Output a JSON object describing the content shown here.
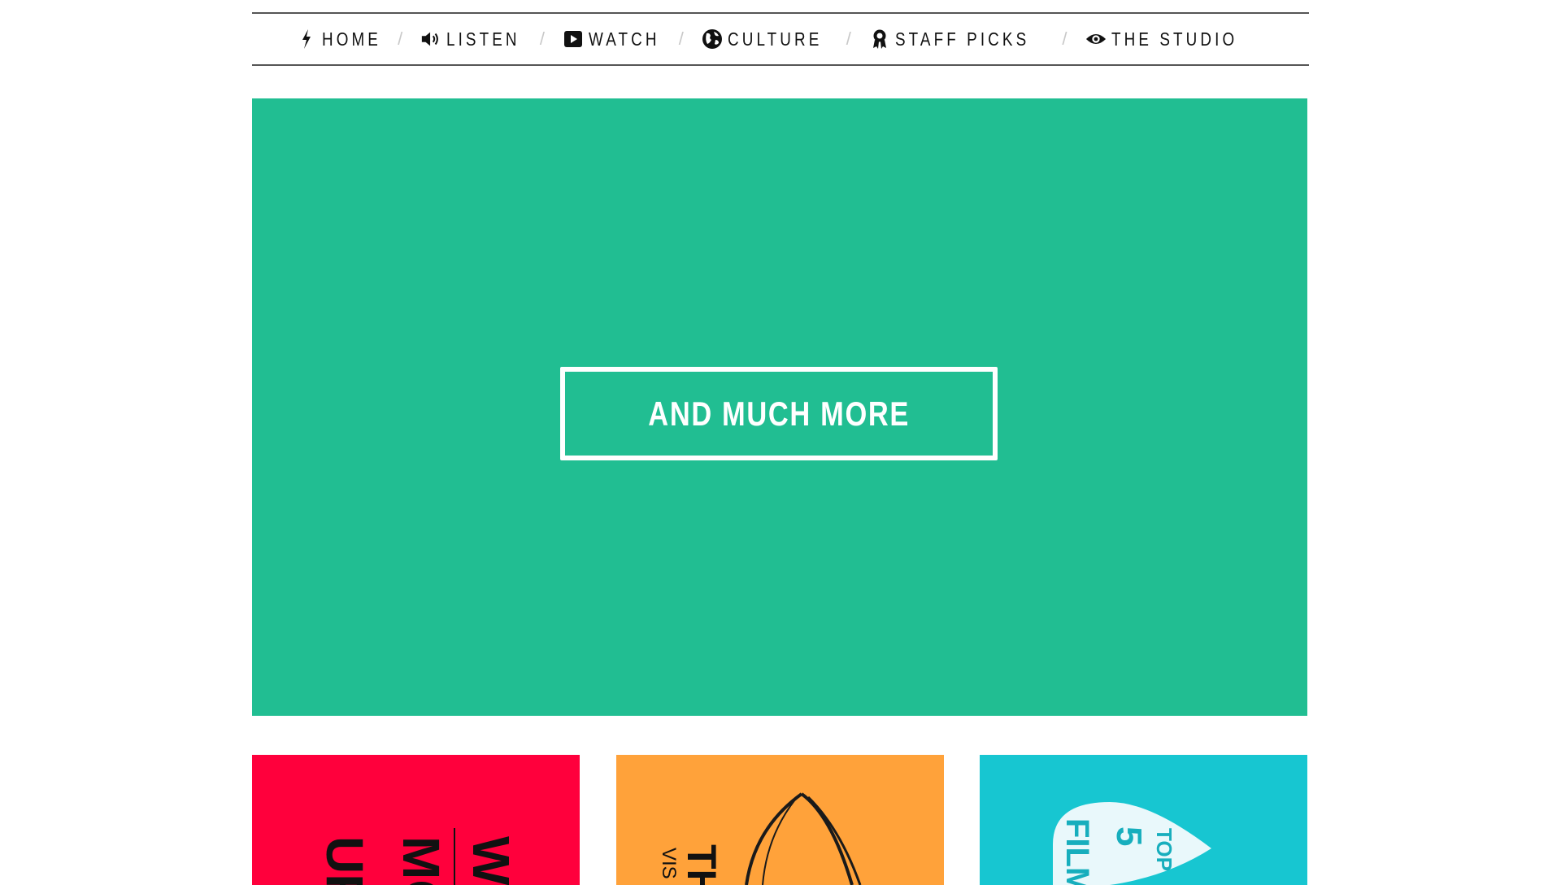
{
  "nav": {
    "items": [
      {
        "label": "HOME",
        "icon": "bolt-icon"
      },
      {
        "label": "LISTEN",
        "icon": "speaker-icon"
      },
      {
        "label": "WATCH",
        "icon": "play-icon"
      },
      {
        "label": "CULTURE",
        "icon": "globe-icon"
      },
      {
        "label": "STAFF PICKS",
        "icon": "award-icon"
      },
      {
        "label": "THE STUDIO",
        "icon": "eye-icon"
      }
    ],
    "separator": "/"
  },
  "hero": {
    "button_label": "AND MUCH MORE",
    "background_color": "#21be92"
  },
  "cards": [
    {
      "background_color": "#ff003c",
      "lines": [
        "W",
        "MO",
        "UF"
      ]
    },
    {
      "background_color": "#ffa23a",
      "lines": [
        "TH",
        "VIS"
      ]
    },
    {
      "background_color": "#17c6d1",
      "lines": [
        "TOP",
        "5",
        "FILMS"
      ]
    }
  ]
}
